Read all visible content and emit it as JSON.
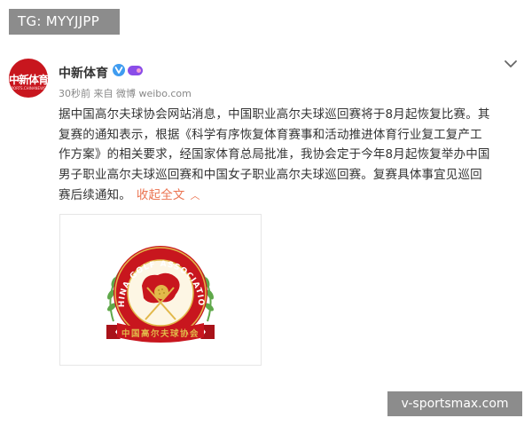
{
  "tag": {
    "text": "TG: MYYJJPP"
  },
  "post": {
    "avatar": {
      "text": "中新体育",
      "subtext": "SPORTS.CHINANEWS.COM"
    },
    "author": "中新体育",
    "meta": "30秒前 来自 微博 weibo.com",
    "lines": [
      "据中国高尔夫球协会网站消息，中国职业高尔夫球巡回赛将于8月起恢复比赛。其",
      "复赛的通知表示，根据《科学有序恢复体育赛事和活动推进体育行业复工复产工",
      "作方案》的相关要求，经国家体育总局批准，我协会定于今年8月起恢复举办中国",
      "男子职业高尔夫球巡回赛和中国女子职业高尔夫球巡回赛。复赛具体事宜见巡回",
      "赛后续通知。"
    ],
    "collapse_label": "收起全文",
    "collapse_arrow": "︿"
  },
  "image": {
    "arc_text": "CHINA GOLF ASSOCIATION",
    "banner_text": "中国高尔夫球协会"
  },
  "watermark": {
    "text": "v-sportsmax.com"
  },
  "colors": {
    "brand_red": "#c8161e",
    "link": "#eb7350",
    "verified": "#3f9cf0",
    "vip": "#8a4de8",
    "logo_gold": "#e2b84a",
    "logo_green": "#5fa84a"
  },
  "icons": [
    "verified-icon",
    "vip-icon",
    "chevron-down-icon"
  ]
}
